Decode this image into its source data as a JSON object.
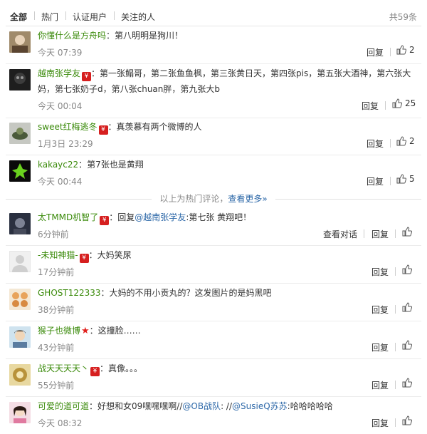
{
  "tabs": [
    {
      "label": "全部"
    },
    {
      "label": "热门"
    },
    {
      "label": "认证用户"
    },
    {
      "label": "关注的人"
    }
  ],
  "total": "共59条",
  "actions": {
    "reply": "回复",
    "view_conversation": "查看对话"
  },
  "hot_separator": {
    "text": "以上为热门评论，",
    "link": "查看更多»"
  },
  "badge_icon": "red-v-verified-badge",
  "colors": {
    "username": "#3a8a0a",
    "mention": "#2d68a8",
    "badge": "#d61f1f",
    "muted": "#888888"
  },
  "comments": [
    {
      "user": "你懂什么是方舟吗",
      "badge": "",
      "text": "：第八明明是狗川！",
      "time": "今天 07:39",
      "likes": "2"
    },
    {
      "user": "越南张学友",
      "badge": "vip",
      "text": "：第一张鳎哥，第二张鱼鱼枫，第三张黄日天，第四张pis，第五张大酒神，第六张大",
      "text2": "妈，第七张奶子d，第八张chuan胖，第九张大b",
      "time": "今天 00:04",
      "likes": "25"
    },
    {
      "user": "sweet红梅逃冬",
      "badge": "vip",
      "text": "：真羡慕有两个微博的人",
      "time": "1月3日 23:29",
      "likes": "2"
    },
    {
      "user": "kakayc22",
      "badge": "",
      "text": "：第7张也是黄翔",
      "time": "今天 00:44",
      "likes": "5"
    },
    {
      "user": "太TMMD机智了",
      "badge": "vip",
      "pre": "：回复",
      "mention": "@越南张学友",
      "text": ":第七张 黄翔吧！",
      "time": "6分钟前",
      "likes": ""
    },
    {
      "user": "-未知神猫-",
      "badge": "vip",
      "text": "：大妈笑尿",
      "time": "17分钟前",
      "likes": ""
    },
    {
      "user": "GHOST122333",
      "badge": "",
      "text": "：大妈的不用小贡丸的？这发图片的是妈黑吧",
      "time": "38分钟前",
      "likes": ""
    },
    {
      "user": "猴子也微博",
      "badge": "star",
      "text": "：这撞脸……",
      "time": "43分钟前",
      "likes": ""
    },
    {
      "user": "战天天天天丶",
      "badge": "vip",
      "text": "：真像。。。",
      "time": "55分钟前",
      "likes": ""
    },
    {
      "user": "可爱的道可道",
      "badge": "",
      "pre": "：好想和女09嘿嘿嘿啊//",
      "mention": "@OB战队",
      "mid": ": //",
      "mention2": "@SusieQ苏苏",
      "text": ":哈哈哈哈哈",
      "time": "今天 08:32",
      "likes": ""
    }
  ]
}
